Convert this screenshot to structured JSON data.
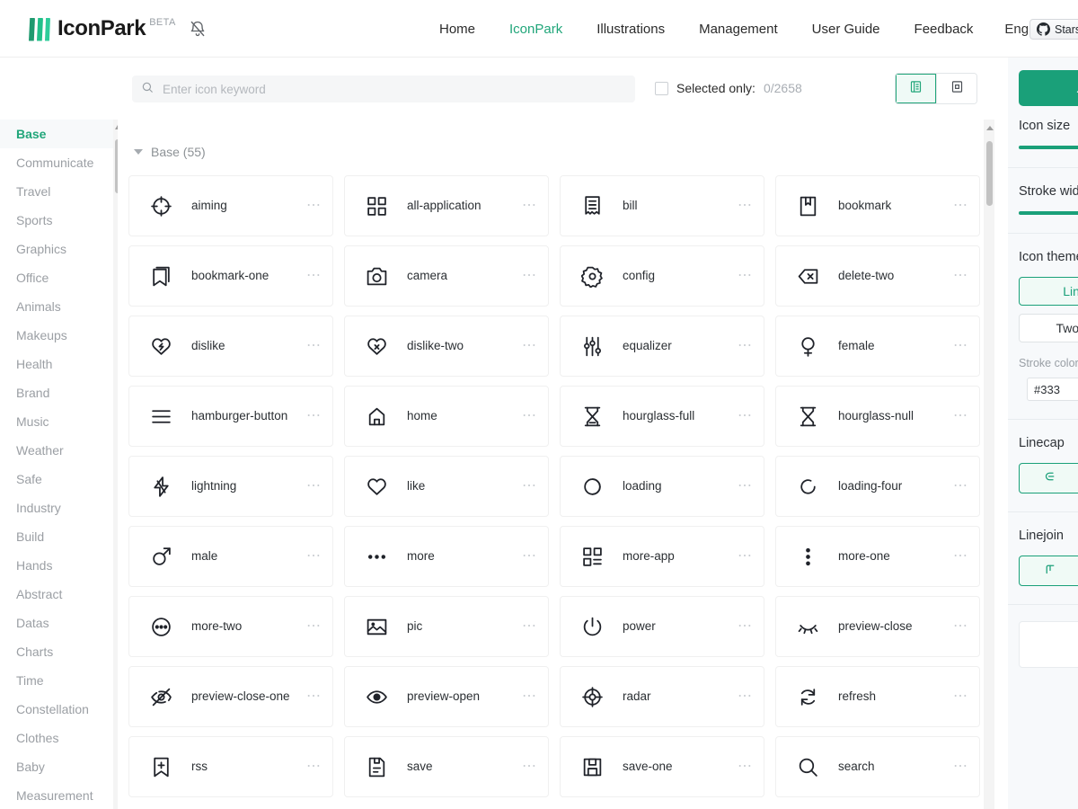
{
  "header": {
    "logo_text": "IconPark",
    "beta_badge": "BETA",
    "bell_icon": "bell-off-icon",
    "nav": [
      {
        "label": "Home",
        "active": false
      },
      {
        "label": "IconPark",
        "active": true
      },
      {
        "label": "Illustrations",
        "active": false
      },
      {
        "label": "Management",
        "active": false
      },
      {
        "label": "User Guide",
        "active": false
      },
      {
        "label": "Feedback",
        "active": false
      }
    ],
    "language": "English",
    "github_stars_label": "Stars",
    "accent_color": "#21a67a"
  },
  "toolbar": {
    "search_placeholder": "Enter icon keyword",
    "search_value": "",
    "search_icon": "search-icon",
    "selected_only_label": "Selected only:",
    "selected_count": "0/2658",
    "view_list_icon": "list-view-icon",
    "view_grid_icon": "grid-view-icon",
    "view_active": "list"
  },
  "sidebar": {
    "categories": [
      {
        "label": "Base",
        "active": true
      },
      {
        "label": "Communicate",
        "active": false
      },
      {
        "label": "Travel",
        "active": false
      },
      {
        "label": "Sports",
        "active": false
      },
      {
        "label": "Graphics",
        "active": false
      },
      {
        "label": "Office",
        "active": false
      },
      {
        "label": "Animals",
        "active": false
      },
      {
        "label": "Makeups",
        "active": false
      },
      {
        "label": "Health",
        "active": false
      },
      {
        "label": "Brand",
        "active": false
      },
      {
        "label": "Music",
        "active": false
      },
      {
        "label": "Weather",
        "active": false
      },
      {
        "label": "Safe",
        "active": false
      },
      {
        "label": "Industry",
        "active": false
      },
      {
        "label": "Build",
        "active": false
      },
      {
        "label": "Hands",
        "active": false
      },
      {
        "label": "Abstract",
        "active": false
      },
      {
        "label": "Datas",
        "active": false
      },
      {
        "label": "Charts",
        "active": false
      },
      {
        "label": "Time",
        "active": false
      },
      {
        "label": "Constellation",
        "active": false
      },
      {
        "label": "Clothes",
        "active": false
      },
      {
        "label": "Baby",
        "active": false
      },
      {
        "label": "Measurement",
        "active": false
      }
    ]
  },
  "main": {
    "group_title": "Base (55)",
    "more_glyph": "⋯",
    "icons": [
      {
        "name": "aiming",
        "icon": "aiming-icon"
      },
      {
        "name": "all-application",
        "icon": "all-application-icon"
      },
      {
        "name": "bill",
        "icon": "bill-icon"
      },
      {
        "name": "bookmark",
        "icon": "bookmark-icon"
      },
      {
        "name": "bookmark-one",
        "icon": "bookmark-one-icon"
      },
      {
        "name": "camera",
        "icon": "camera-icon"
      },
      {
        "name": "config",
        "icon": "config-icon"
      },
      {
        "name": "delete-two",
        "icon": "delete-two-icon"
      },
      {
        "name": "dislike",
        "icon": "dislike-icon"
      },
      {
        "name": "dislike-two",
        "icon": "dislike-two-icon"
      },
      {
        "name": "equalizer",
        "icon": "equalizer-icon"
      },
      {
        "name": "female",
        "icon": "female-icon"
      },
      {
        "name": "hamburger-button",
        "icon": "hamburger-button-icon"
      },
      {
        "name": "home",
        "icon": "home-icon"
      },
      {
        "name": "hourglass-full",
        "icon": "hourglass-full-icon"
      },
      {
        "name": "hourglass-null",
        "icon": "hourglass-null-icon"
      },
      {
        "name": "lightning",
        "icon": "lightning-icon"
      },
      {
        "name": "like",
        "icon": "like-icon"
      },
      {
        "name": "loading",
        "icon": "loading-icon"
      },
      {
        "name": "loading-four",
        "icon": "loading-four-icon"
      },
      {
        "name": "male",
        "icon": "male-icon"
      },
      {
        "name": "more",
        "icon": "more-icon"
      },
      {
        "name": "more-app",
        "icon": "more-app-icon"
      },
      {
        "name": "more-one",
        "icon": "more-one-icon"
      },
      {
        "name": "more-two",
        "icon": "more-two-icon"
      },
      {
        "name": "pic",
        "icon": "pic-icon"
      },
      {
        "name": "power",
        "icon": "power-icon"
      },
      {
        "name": "preview-close",
        "icon": "preview-close-icon"
      },
      {
        "name": "preview-close-one",
        "icon": "preview-close-one-icon"
      },
      {
        "name": "preview-open",
        "icon": "preview-open-icon"
      },
      {
        "name": "radar",
        "icon": "radar-icon"
      },
      {
        "name": "refresh",
        "icon": "refresh-icon"
      },
      {
        "name": "rss",
        "icon": "rss-icon"
      },
      {
        "name": "save",
        "icon": "save-icon"
      },
      {
        "name": "save-one",
        "icon": "save-one-icon"
      },
      {
        "name": "search",
        "icon": "search-result-icon"
      }
    ]
  },
  "rightpanel": {
    "download_icon": "download-icon",
    "icon_size_label": "Icon size",
    "icon_size_fill_pct": 82,
    "stroke_width_label": "Stroke wid",
    "stroke_width_fill_pct": 100,
    "icon_theme_label": "Icon theme",
    "theme_outline_label": "Line",
    "theme_twotone_label": "Two-to",
    "stroke_color_label": "Stroke color",
    "stroke_color_value": "#333",
    "stroke_color_swatch": "#333333",
    "linecap_label": "Linecap",
    "linecap_icon": "linecap-butt-icon",
    "linejoin_label": "Linejoin",
    "linejoin_icon": "linejoin-miter-icon"
  }
}
